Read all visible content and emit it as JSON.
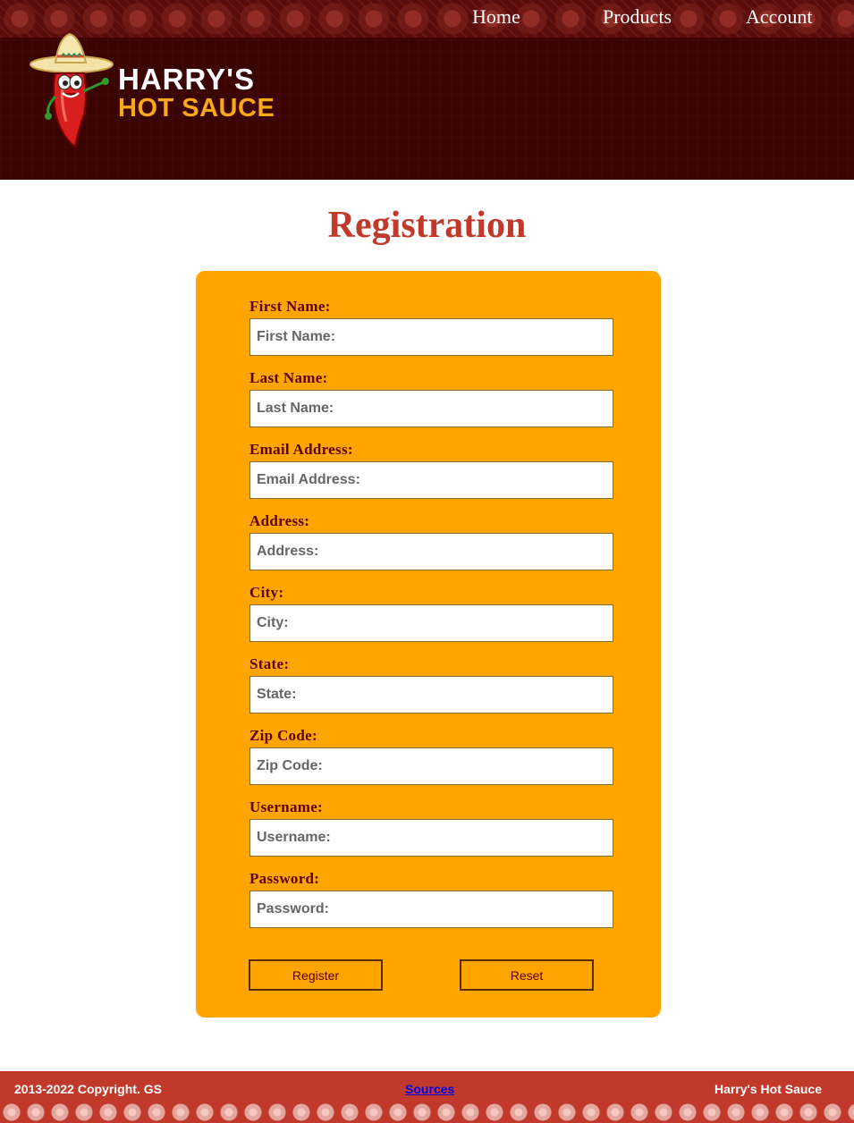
{
  "nav": {
    "home": "Home",
    "products": "Products",
    "account": "Account"
  },
  "brand": {
    "line1": "HARRY'S",
    "line2": "HOT SAUCE",
    "mascot": "chili-pepper-sombrero-icon"
  },
  "page": {
    "title": "Registration"
  },
  "form": {
    "fields": [
      {
        "label": "First Name:",
        "placeholder": "First Name:"
      },
      {
        "label": "Last Name:",
        "placeholder": "Last Name:"
      },
      {
        "label": "Email Address:",
        "placeholder": "Email Address:"
      },
      {
        "label": "Address:",
        "placeholder": "Address:"
      },
      {
        "label": "City:",
        "placeholder": "City:"
      },
      {
        "label": "State:",
        "placeholder": "State:"
      },
      {
        "label": "Zip Code:",
        "placeholder": "Zip Code:"
      },
      {
        "label": "Username:",
        "placeholder": "Username:"
      },
      {
        "label": "Password:",
        "placeholder": "Password:"
      }
    ],
    "register_label": "Register",
    "reset_label": "Reset"
  },
  "footer": {
    "copyright": "2013-2022 Copyright. GS",
    "sources": "Sources",
    "brand": "Harry's Hot Sauce"
  },
  "colors": {
    "header_bg": "#3a0404",
    "title": "#c0392b",
    "form_bg": "#ffa500",
    "footer_bg": "#c0392b",
    "logo_accent": "#f8a81c"
  }
}
